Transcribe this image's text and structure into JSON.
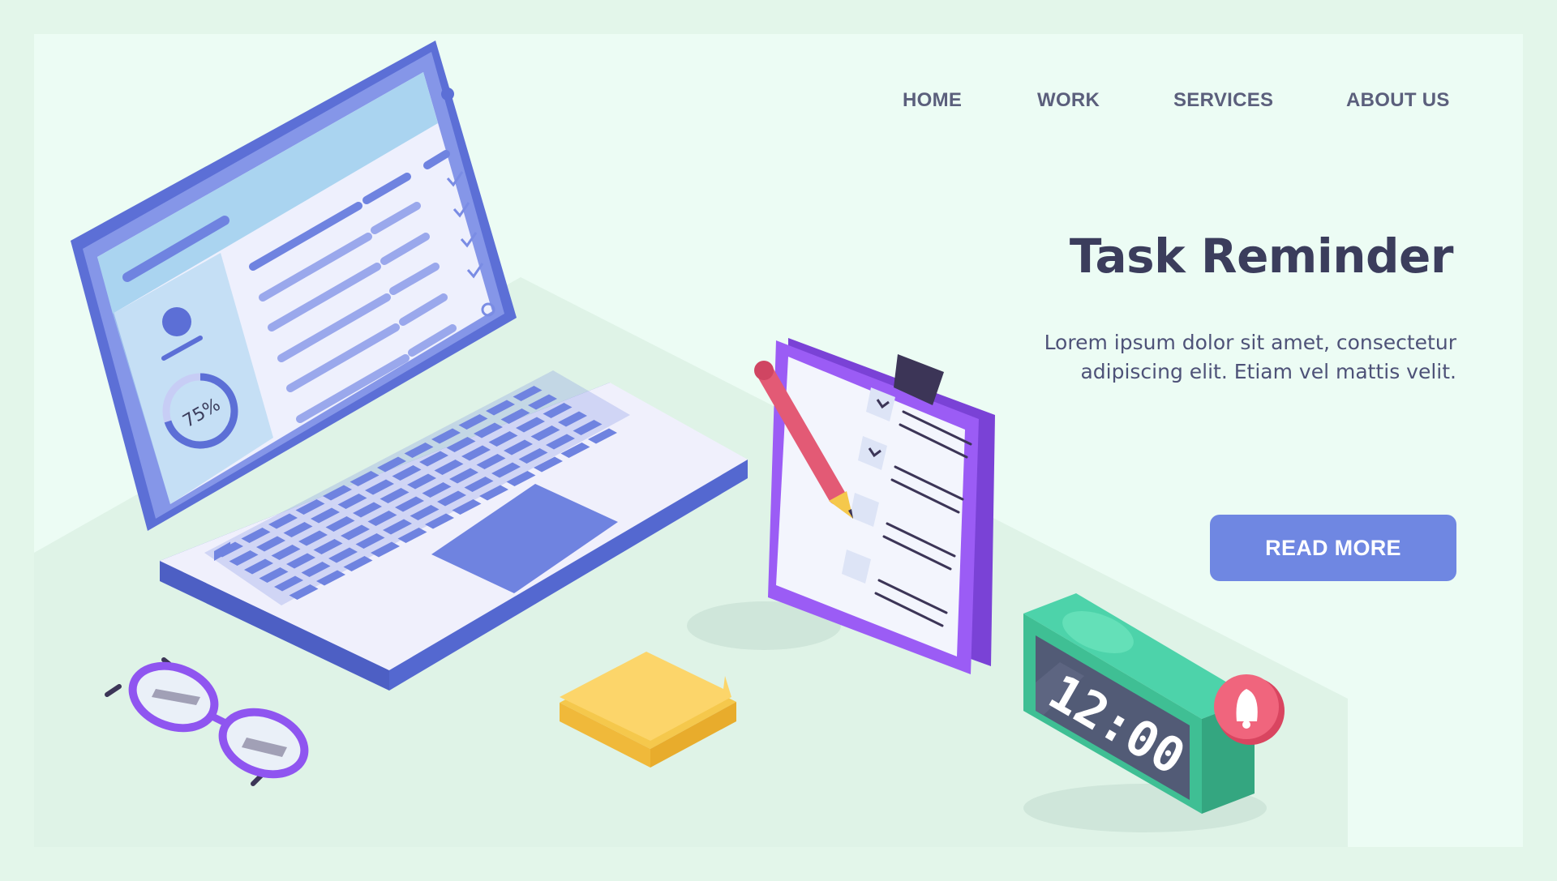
{
  "nav": {
    "items": [
      "HOME",
      "WORK",
      "SERVICES",
      "ABOUT US"
    ]
  },
  "hero": {
    "title": "Task Reminder",
    "description": "Lorem ipsum dolor sit amet, consectetur adipiscing elit. Etiam vel mattis velit.",
    "button_label": "READ MORE"
  },
  "illustration": {
    "laptop_progress_label": "75%",
    "laptop_progress_value": 0.75,
    "clock_time": "12:00"
  },
  "icons": [
    "laptop-icon",
    "clipboard-checklist-icon",
    "pencil-icon",
    "alarm-clock-icon",
    "bell-icon",
    "glasses-icon",
    "sticky-note-icon",
    "user-avatar-icon"
  ],
  "colors": {
    "background": "#e3f6ea",
    "page": "#ecfcf4",
    "accent": "#6f87e2",
    "title": "#3b3d5c",
    "laptop": "#5c6fd6",
    "clipboard": "#8f55f0",
    "clock": "#3fbf94",
    "bell": "#e85a72",
    "note": "#f5c84c"
  }
}
